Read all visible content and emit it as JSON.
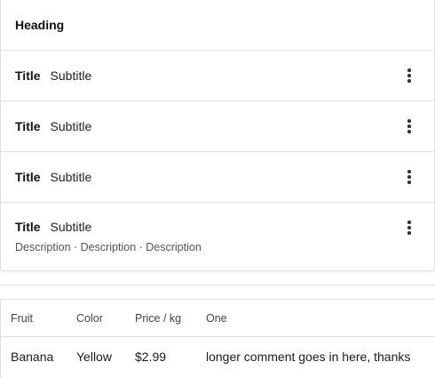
{
  "list": {
    "heading": "Heading",
    "items": [
      {
        "title": "Title",
        "subtitle": "Subtitle",
        "description": ""
      },
      {
        "title": "Title",
        "subtitle": "Subtitle",
        "description": ""
      },
      {
        "title": "Title",
        "subtitle": "Subtitle",
        "description": ""
      },
      {
        "title": "Title",
        "subtitle": "Subtitle",
        "description": "Description · Description · Description"
      }
    ],
    "more_icon": "more-vertical-icon"
  },
  "table": {
    "columns": [
      "Fruit",
      "Color",
      "Price / kg",
      "One"
    ],
    "rows": [
      [
        "Banana",
        "Yellow",
        "$2.99",
        "longer comment goes in here, thanks"
      ]
    ]
  },
  "colors": {
    "border": "#e0e0e0",
    "text": "#1f1f1f",
    "muted": "#555555"
  }
}
